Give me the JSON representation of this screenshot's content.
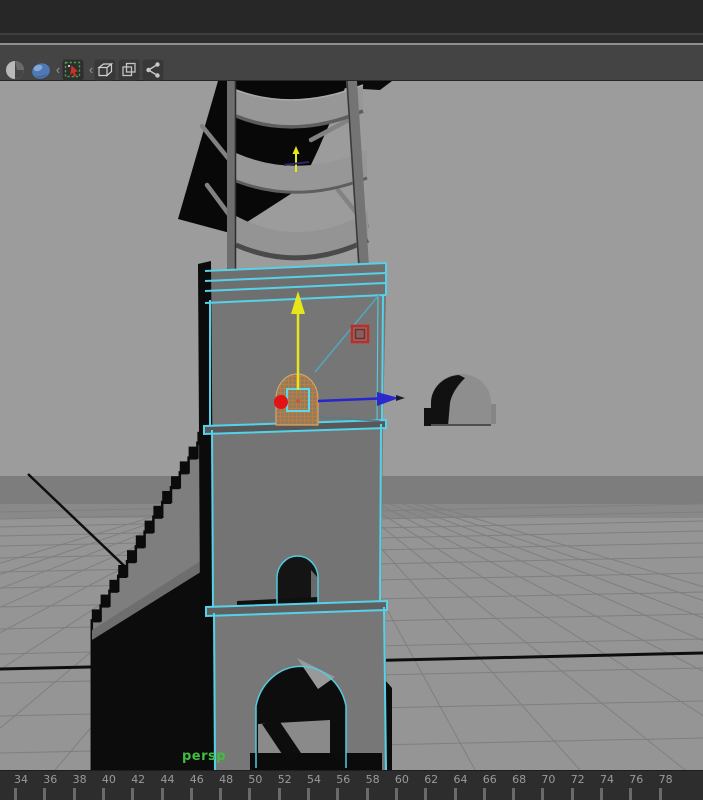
{
  "titlebar": {
    "title": ""
  },
  "toolbar": {
    "icons": [
      {
        "id": "shaded-display-icon"
      },
      {
        "id": "smooth-shade-icon"
      },
      {
        "id": "marquee-select-icon"
      },
      {
        "id": "poly-cube-icon"
      },
      {
        "id": "duplicate-icon"
      },
      {
        "id": "share-icon"
      }
    ],
    "separator_glyph": "‹"
  },
  "viewport": {
    "camera_label": "persp",
    "scene": {
      "selected_object": "tower-with-flags",
      "selection_color": "#55d2e8",
      "manipulator": {
        "x_color": "#e41212",
        "y_color": "#e6e61c",
        "z_color": "#2626cc"
      },
      "background_color": "#9c9c9c",
      "ground_color": "#959595"
    }
  },
  "timeline": {
    "frames": [
      34,
      36,
      38,
      40,
      42,
      44,
      46,
      48,
      50,
      52,
      54,
      56,
      58,
      60,
      62,
      64,
      66,
      68,
      70,
      72,
      74,
      76,
      78
    ]
  }
}
